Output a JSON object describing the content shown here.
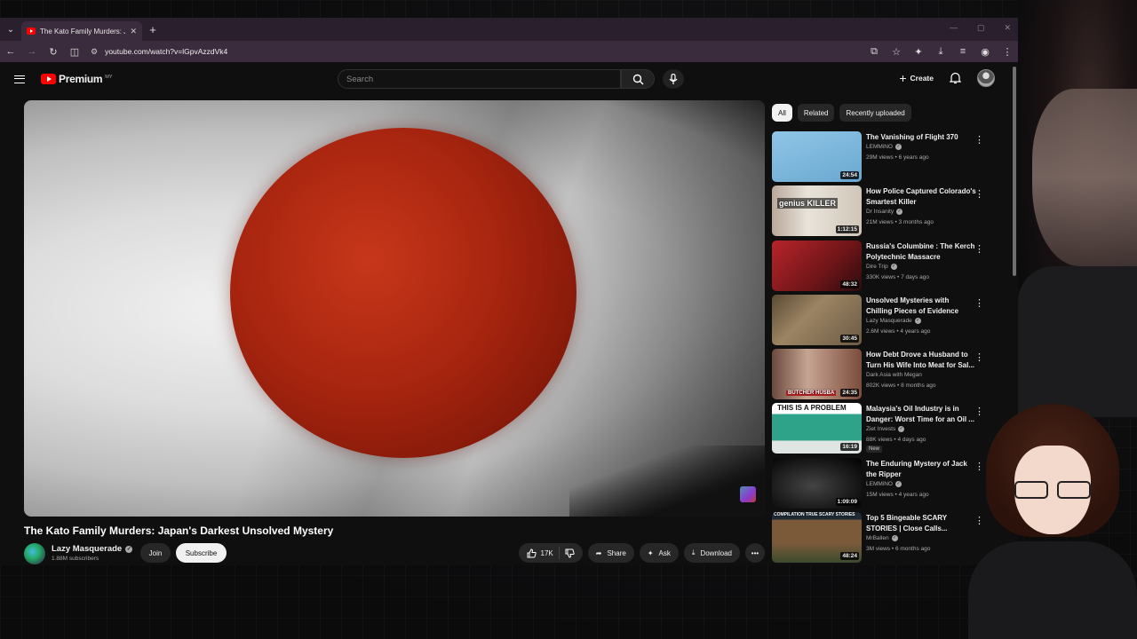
{
  "browser": {
    "tab_title": "The Kato Family Murders: Japan'",
    "url": "youtube.com/watch?v=lGpvAzzdVk4"
  },
  "header": {
    "logo_text": "Premium",
    "logo_region": "MY",
    "search_placeholder": "Search",
    "create_label": "Create"
  },
  "video": {
    "title": "The Kato Family Murders: Japan's Darkest Unsolved Mystery",
    "channel": "Lazy Masquerade",
    "subscribers": "1.88M subscribers",
    "join_label": "Join",
    "subscribe_label": "Subscribe",
    "likes": "17K",
    "share_label": "Share",
    "ask_label": "Ask",
    "download_label": "Download"
  },
  "chips": [
    "All",
    "Related",
    "Recently uploaded"
  ],
  "recommendations": [
    {
      "title": "The Vanishing of Flight 370",
      "channel": "LEMMiNO",
      "verified": true,
      "meta": "29M views • 6 years ago",
      "duration": "24:54",
      "thumb_text": ""
    },
    {
      "title": "How Police Captured Colorado's Smartest Killer",
      "channel": "Dr Insanity",
      "verified": true,
      "meta": "21M views • 3 months ago",
      "duration": "1:12:15",
      "thumb_text": "genius KILLER"
    },
    {
      "title": "Russia's Columbine : The Kerch Polytechnic Massacre",
      "channel": "Dire Trip",
      "verified": true,
      "meta": "330K views • 7 days ago",
      "duration": "48:32",
      "thumb_text": ""
    },
    {
      "title": "Unsolved Mysteries with Chilling Pieces of Evidence",
      "channel": "Lazy Masquerade",
      "verified": true,
      "meta": "2.6M views • 4 years ago",
      "duration": "30:45",
      "thumb_text": ""
    },
    {
      "title": "How Debt Drove a Husband to Turn His Wife Into Meat for Sal...",
      "channel": "Dark Asia with Megan",
      "verified": false,
      "meta": "802K views • 8 months ago",
      "duration": "24:35",
      "thumb_text": "BUTCHER HUSBA"
    },
    {
      "title": "Malaysia's Oil Industry is in Danger: Worst Time for an Oil ...",
      "channel": "Ziet Invests",
      "verified": true,
      "meta": "88K views • 4 days ago",
      "duration": "16:19",
      "thumb_text": "THIS IS A PROBLEM",
      "badge": "New"
    },
    {
      "title": "The Enduring Mystery of Jack the Ripper",
      "channel": "LEMMiNO",
      "verified": true,
      "meta": "15M views • 4 years ago",
      "duration": "1:09:09",
      "thumb_text": ""
    },
    {
      "title": "Top 5 Bingeable SCARY STORIES | Close Calls...",
      "channel": "MrBallen",
      "verified": true,
      "meta": "3M views • 6 months ago",
      "duration": "48:24",
      "thumb_text": "COMPILATION TRUE SCARY STORIES"
    }
  ],
  "icons": {
    "more": "⋮",
    "verified": "✓"
  }
}
